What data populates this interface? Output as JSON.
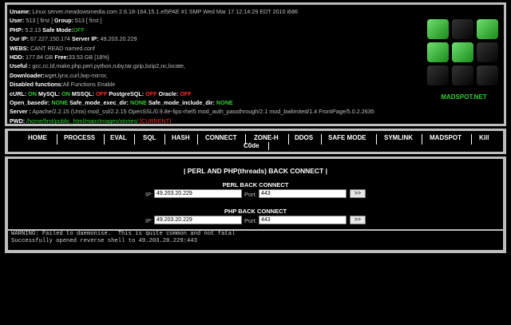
{
  "info": {
    "uname_label": "Uname:",
    "uname": "Linux server.meadowsmedia.com 2.6.18-164.15.1.el5PAE #1 SMP Wed Mar 17 12:14:29 EDT 2010 i686",
    "user_label": "User:",
    "user": "513 [ first ]",
    "group_label": "Group:",
    "group": "513 [ first ]",
    "php_label": "PHP:",
    "php": "5.2.13",
    "safe_mode_label": "Safe Mode:",
    "safe_mode": "OFF",
    "ourip_label": "Our IP:",
    "ourip": "67.227.150.174",
    "serverip_label": "Server IP:",
    "serverip": "49.203.20.229",
    "webs_label": "WEBS:",
    "webs": "CANT READ named.conf",
    "hdd_label": "HDD:",
    "hdd": "177.84 GB",
    "free_label": "Free:",
    "free": "33.53 GB [18%]",
    "useful_label": "Useful :",
    "useful": "gcc,cc,ld,make,php,perl,python,ruby,tar,gzip,bzip2,nc,locate,",
    "downloader_label": "Downloader:",
    "downloader": "wget,lynx,curl,lwp-mirror,",
    "disabled_label": "Disabled functions:",
    "disabled": "All Functions Enable",
    "curl_label": "cURL:",
    "curl": "ON",
    "mysql_label": "MySQL:",
    "mysql": "ON",
    "mssql_label": "MSSQL:",
    "mssql": "OFF",
    "pg_label": "PostgreSQL:",
    "pg": "OFF",
    "oracle_label": "Oracle:",
    "oracle": "OFF",
    "openbase_label": "Open_basedir:",
    "openbase": "NONE",
    "sm_exec_label": "Safe_mode_exec_dir:",
    "sm_exec": "NONE",
    "sm_incl_label": "Safe_mode_include_dir:",
    "sm_incl": "NONE",
    "server_label": "Server :",
    "server": "Apache/2.2.15 (Unix) mod_ssl/2.2.15 OpenSSL/0.9.8e-fips-rhel5 mod_auth_passthrough/2.1 mod_bwlimited/1.4 FrontPage/5.0.2.2635",
    "pwd_label": "PWD:",
    "pwd": "/home/first/public_html/main/images/stories/",
    "pwd_current": "[CURRENT]"
  },
  "logo": {
    "text": "MADSPOT.NET",
    "colors": [
      "#33cc33",
      "#111111",
      "#ffffff"
    ]
  },
  "nav": [
    "HOME",
    "PROCESS",
    "EVAL",
    "SQL",
    "HASH",
    "CONNECT",
    "ZONE-H",
    "DDOS",
    "SAFE MODE",
    "SYMLINK",
    "MADSPOT",
    "Kill",
    "C0de"
  ],
  "backconnect": {
    "title": "| PERL AND PHP(threads) BACK CONNECT |",
    "perl_title": "PERL BACK CONNECT",
    "php_title": "PHP BACK CONNECT",
    "ip_label": "IP:",
    "port_label": "Port:",
    "perl_ip": "49.203.20.229",
    "perl_port": "443",
    "php_ip": "49.203.20.229",
    "php_port": "443",
    "go": ">>"
  },
  "output": [
    "WARNING: Failed to daemonise.  This is quite common and not fatal",
    "Successfully opened reverse shell to 49.203.20.229:443"
  ]
}
